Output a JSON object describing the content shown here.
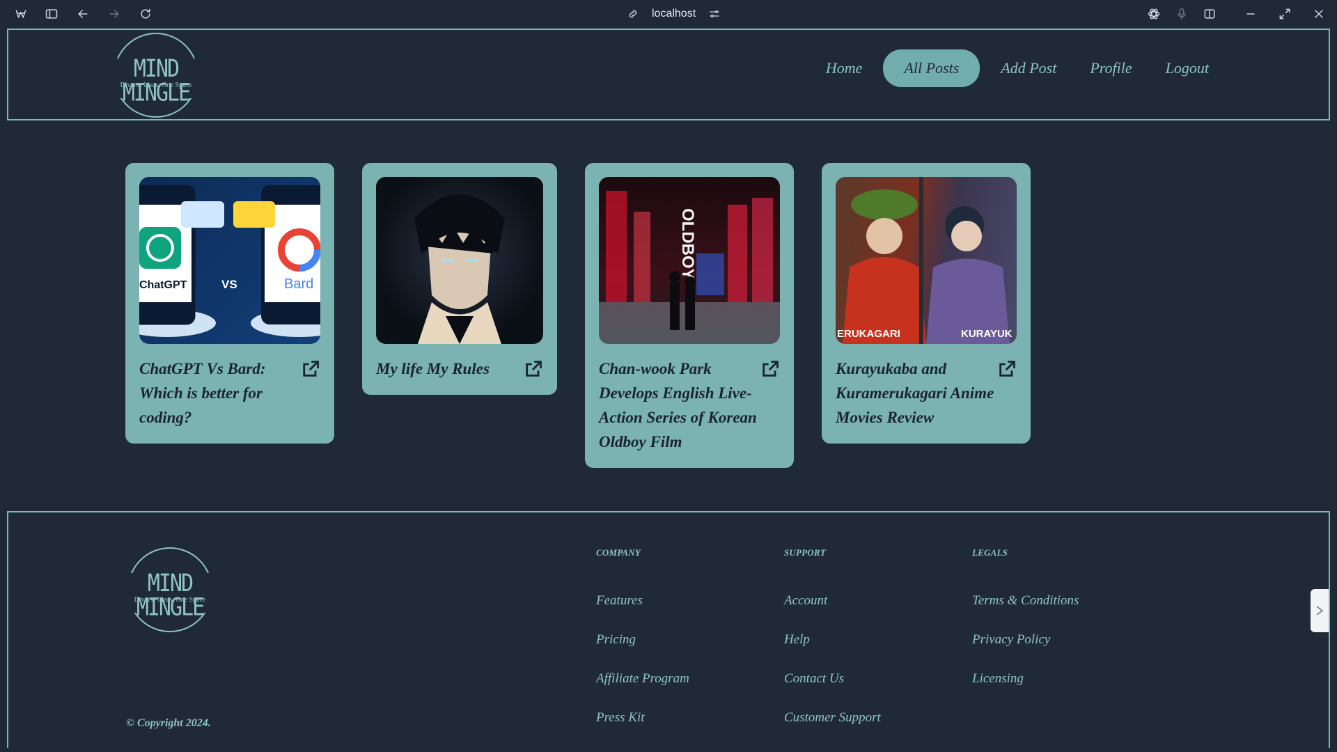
{
  "browser": {
    "url": "localhost"
  },
  "brand": {
    "name": "MIND MINGLE",
    "tagline": "Diverse Ideas. One Space"
  },
  "nav": {
    "items": [
      {
        "label": "Home",
        "active": false
      },
      {
        "label": "All Posts",
        "active": true
      },
      {
        "label": "Add Post",
        "active": false
      },
      {
        "label": "Profile",
        "active": false
      },
      {
        "label": "Logout",
        "active": false
      }
    ]
  },
  "posts": [
    {
      "title": "ChatGPT Vs Bard: Which is better for coding?",
      "thumb_text_left": "ChatGPT",
      "thumb_text_mid": "VS",
      "thumb_text_right": "Bard"
    },
    {
      "title": "My life My Rules"
    },
    {
      "title": "Chan-wook Park Develops English Live-Action Series of Korean Oldboy Film",
      "thumb_text": "OLDBOY"
    },
    {
      "title": "Kurayukaba and Kuramerukagari Anime Movies Review",
      "thumb_text_left": "ERUKAGARI",
      "thumb_text_right": "KURAYUK"
    }
  ],
  "footer": {
    "columns": [
      {
        "heading": "COMPANY",
        "links": [
          "Features",
          "Pricing",
          "Affiliate Program",
          "Press Kit"
        ]
      },
      {
        "heading": "SUPPORT",
        "links": [
          "Account",
          "Help",
          "Contact Us",
          "Customer Support"
        ]
      },
      {
        "heading": "LEGALS",
        "links": [
          "Terms & Conditions",
          "Privacy Policy",
          "Licensing"
        ]
      }
    ],
    "copyright": "© Copyright 2024."
  },
  "colors": {
    "background": "#1f2a36",
    "accent": "#7bb2b2",
    "text": "#8fc4c4"
  }
}
